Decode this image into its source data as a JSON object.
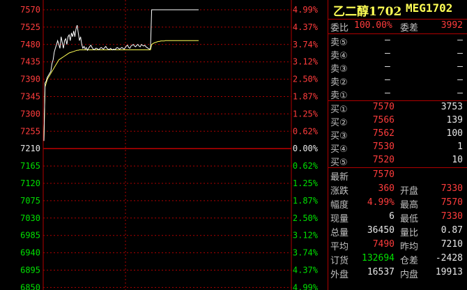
{
  "chart": {
    "price_ticks": [
      "7570",
      "7525",
      "7480",
      "7435",
      "7390",
      "7345",
      "7300",
      "7255",
      "7210",
      "7165",
      "7120",
      "7075",
      "7030",
      "6985",
      "6940",
      "6895",
      "6850"
    ],
    "pct_ticks": [
      "4.99%",
      "4.37%",
      "3.74%",
      "3.12%",
      "2.50%",
      "1.87%",
      "1.25%",
      "0.62%",
      "0.00%",
      "0.62%",
      "1.25%",
      "1.87%",
      "2.50%",
      "3.12%",
      "3.74%",
      "4.37%",
      "4.99%"
    ],
    "base_price": 7210,
    "price_max": 7570,
    "price_min": 6850,
    "colors": {
      "up": "#ff3c3c",
      "down": "#00e000",
      "flat": "#e8e8e8",
      "grid": "#b00000",
      "price_line": "#ffffff",
      "avg_line": "#ffff55"
    }
  },
  "chart_data": {
    "type": "line",
    "ylim": [
      6850,
      7570
    ],
    "series": [
      {
        "values": [
          7230,
          7380,
          7385,
          7395,
          7400,
          7405,
          7410,
          7430,
          7440,
          7460,
          7470,
          7480,
          7490,
          7480,
          7470,
          7500,
          7485,
          7470,
          7490,
          7495,
          7480,
          7500,
          7505,
          7490,
          7510,
          7500,
          7515,
          7500,
          7520,
          7530,
          7510,
          7490,
          7500,
          7480,
          7470,
          7475,
          7468,
          7472,
          7465,
          7470,
          7475,
          7478,
          7472,
          7468,
          7466,
          7470,
          7470,
          7468,
          7466,
          7470,
          7472,
          7470,
          7468,
          7472,
          7475,
          7470,
          7468,
          7466,
          7470,
          7468,
          7466,
          7468,
          7466,
          7470,
          7472,
          7470,
          7468,
          7470,
          7472,
          7470,
          7468,
          7472,
          7476,
          7478,
          7472,
          7470,
          7476,
          7478,
          7480,
          7476,
          7474,
          7478,
          7480,
          7476,
          7474,
          7480,
          7478,
          7476,
          7478,
          7474,
          7472,
          7470,
          7468,
          7470,
          7570,
          7570,
          7570,
          7570,
          7570,
          7570,
          7570,
          7570,
          7570,
          7570,
          7570,
          7570,
          7570,
          7570,
          7570,
          7570,
          7570,
          7570,
          7570,
          7570,
          7570,
          7570,
          7570,
          7570,
          7570,
          7570,
          7570,
          7570,
          7570,
          7570,
          7570,
          7570,
          7570,
          7570,
          7570,
          7570,
          7570,
          7570,
          7570,
          7570,
          7570,
          7570
        ]
      },
      {
        "values": [
          7230,
          7370,
          7380,
          7390,
          7395,
          7400,
          7405,
          7410,
          7415,
          7420,
          7425,
          7430,
          7435,
          7440,
          7442,
          7444,
          7446,
          7448,
          7450,
          7452,
          7454,
          7456,
          7458,
          7459,
          7460,
          7461,
          7462,
          7463,
          7464,
          7465,
          7465,
          7466,
          7466,
          7466,
          7466,
          7466,
          7466,
          7466,
          7466,
          7466,
          7466,
          7466,
          7466,
          7466,
          7466,
          7466,
          7466,
          7466,
          7466,
          7466,
          7466,
          7466,
          7466,
          7466,
          7466,
          7466,
          7466,
          7466,
          7466,
          7466,
          7466,
          7466,
          7466,
          7466,
          7466,
          7466,
          7466,
          7466,
          7466,
          7466,
          7466,
          7466,
          7466,
          7466,
          7466,
          7466,
          7466,
          7466,
          7466,
          7466,
          7466,
          7466,
          7466,
          7466,
          7466,
          7466,
          7466,
          7466,
          7466,
          7466,
          7466,
          7466,
          7466,
          7466,
          7480,
          7482,
          7484,
          7485,
          7486,
          7487,
          7488,
          7488,
          7489,
          7489,
          7489,
          7489,
          7490,
          7490,
          7490,
          7490,
          7490,
          7490,
          7490,
          7490,
          7490,
          7490,
          7490,
          7490,
          7490,
          7490,
          7490,
          7490,
          7490,
          7490,
          7490,
          7490,
          7490,
          7490,
          7490,
          7490,
          7490,
          7490,
          7490,
          7490,
          7490,
          7490
        ]
      }
    ]
  },
  "quote": {
    "title_cn": "乙二醇1702",
    "title_code": "MEG1702",
    "weibi_label": "委比",
    "weibi_value": "100.00%",
    "weicha_label": "委差",
    "weicha_value": "3992",
    "sells": [
      {
        "label": "卖⑤",
        "price": "—",
        "vol": "—"
      },
      {
        "label": "卖④",
        "price": "—",
        "vol": "—"
      },
      {
        "label": "卖③",
        "price": "—",
        "vol": "—"
      },
      {
        "label": "卖②",
        "price": "—",
        "vol": "—"
      },
      {
        "label": "卖①",
        "price": "—",
        "vol": "—"
      }
    ],
    "buys": [
      {
        "label": "买①",
        "price": "7570",
        "vol": "3753"
      },
      {
        "label": "买②",
        "price": "7566",
        "vol": "139"
      },
      {
        "label": "买③",
        "price": "7562",
        "vol": "100"
      },
      {
        "label": "买④",
        "price": "7530",
        "vol": "1"
      },
      {
        "label": "买⑤",
        "price": "7520",
        "vol": "10"
      }
    ],
    "stats": [
      {
        "l1": "最新",
        "v1": "7570",
        "c1": "red",
        "l2": "",
        "v2": "",
        "c2": "white"
      },
      {
        "l1": "涨跌",
        "v1": "360",
        "c1": "red",
        "l2": "开盘",
        "v2": "7330",
        "c2": "red"
      },
      {
        "l1": "幅度",
        "v1": "4.99%",
        "c1": "red",
        "l2": "最高",
        "v2": "7570",
        "c2": "red"
      },
      {
        "l1": "现量",
        "v1": "6",
        "c1": "white",
        "l2": "最低",
        "v2": "7330",
        "c2": "red"
      },
      {
        "l1": "总量",
        "v1": "36450",
        "c1": "white",
        "l2": "量比",
        "v2": "0.87",
        "c2": "white"
      },
      {
        "l1": "平均",
        "v1": "7490",
        "c1": "red",
        "l2": "昨均",
        "v2": "7210",
        "c2": "white"
      },
      {
        "l1": "订货",
        "v1": "132694",
        "c1": "green",
        "l2": "仓差",
        "v2": "-2428",
        "c2": "white"
      },
      {
        "l1": "外盘",
        "v1": "16537",
        "c1": "white",
        "l2": "内盘",
        "v2": "19913",
        "c2": "white"
      }
    ]
  }
}
